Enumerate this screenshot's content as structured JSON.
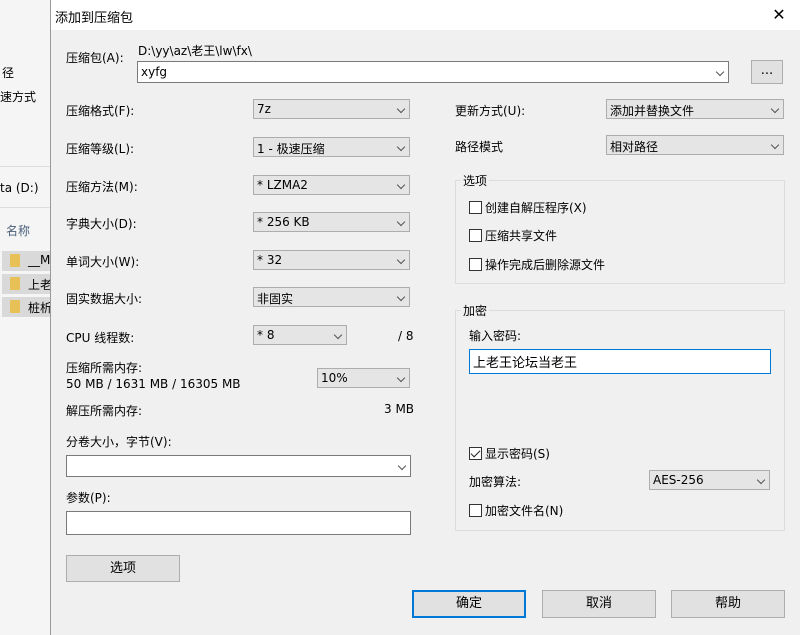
{
  "background": {
    "labels": [
      "径",
      "速方式",
      "ta (D:)",
      "名称"
    ],
    "files": [
      "__M",
      "上老",
      "桩析"
    ]
  },
  "dialog": {
    "title": "添加到压缩包",
    "archive": {
      "label": "压缩包(A):",
      "path": "D:\\yy\\az\\老王\\lw\\fx\\",
      "value": "xyfg",
      "browse": "..."
    },
    "left": {
      "format": {
        "label": "压缩格式(F):",
        "value": "7z"
      },
      "level": {
        "label": "压缩等级(L):",
        "value": "1 - 极速压缩"
      },
      "method": {
        "label": "压缩方法(M):",
        "value": "* LZMA2"
      },
      "dict": {
        "label": "字典大小(D):",
        "value": "* 256 KB"
      },
      "word": {
        "label": "单词大小(W):",
        "value": "* 32"
      },
      "solid": {
        "label": "固实数据大小:",
        "value": "非固实"
      },
      "cpu": {
        "label": "CPU 线程数:",
        "value": "* 8",
        "max": "/ 8"
      },
      "mem": {
        "label": "压缩所需内存:",
        "detail": "50 MB / 1631 MB / 16305 MB",
        "value": "10%"
      },
      "decomp": {
        "label": "解压所需内存:",
        "value": "3 MB"
      },
      "volume": {
        "label": "分卷大小，字节(V):",
        "value": ""
      },
      "params": {
        "label": "参数(P):",
        "value": ""
      },
      "options_button": "选项"
    },
    "right": {
      "update": {
        "label": "更新方式(U):",
        "value": "添加并替换文件"
      },
      "pathmode": {
        "label": "路径模式",
        "value": "相对路径"
      },
      "options": {
        "title": "选项",
        "sfx": "创建自解压程序(X)",
        "shared": "压缩共享文件",
        "delete": "操作完成后删除源文件"
      },
      "encryption": {
        "title": "加密",
        "password_label": "输入密码:",
        "password": "上老王论坛当老王",
        "show_password": "显示密码(S)",
        "method_label": "加密算法:",
        "method": "AES-256",
        "encrypt_names": "加密文件名(N)"
      }
    },
    "buttons": {
      "ok": "确定",
      "cancel": "取消",
      "help": "帮助"
    }
  }
}
